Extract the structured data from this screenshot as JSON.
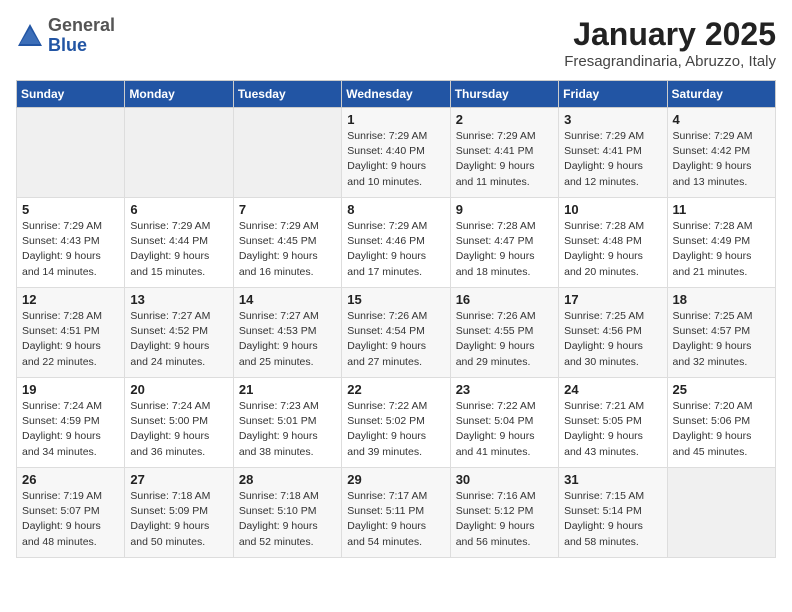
{
  "header": {
    "logo_general": "General",
    "logo_blue": "Blue",
    "month": "January 2025",
    "location": "Fresagrandinaria, Abruzzo, Italy"
  },
  "days_of_week": [
    "Sunday",
    "Monday",
    "Tuesday",
    "Wednesday",
    "Thursday",
    "Friday",
    "Saturday"
  ],
  "weeks": [
    [
      {
        "day": "",
        "info": ""
      },
      {
        "day": "",
        "info": ""
      },
      {
        "day": "",
        "info": ""
      },
      {
        "day": "1",
        "info": "Sunrise: 7:29 AM\nSunset: 4:40 PM\nDaylight: 9 hours\nand 10 minutes."
      },
      {
        "day": "2",
        "info": "Sunrise: 7:29 AM\nSunset: 4:41 PM\nDaylight: 9 hours\nand 11 minutes."
      },
      {
        "day": "3",
        "info": "Sunrise: 7:29 AM\nSunset: 4:41 PM\nDaylight: 9 hours\nand 12 minutes."
      },
      {
        "day": "4",
        "info": "Sunrise: 7:29 AM\nSunset: 4:42 PM\nDaylight: 9 hours\nand 13 minutes."
      }
    ],
    [
      {
        "day": "5",
        "info": "Sunrise: 7:29 AM\nSunset: 4:43 PM\nDaylight: 9 hours\nand 14 minutes."
      },
      {
        "day": "6",
        "info": "Sunrise: 7:29 AM\nSunset: 4:44 PM\nDaylight: 9 hours\nand 15 minutes."
      },
      {
        "day": "7",
        "info": "Sunrise: 7:29 AM\nSunset: 4:45 PM\nDaylight: 9 hours\nand 16 minutes."
      },
      {
        "day": "8",
        "info": "Sunrise: 7:29 AM\nSunset: 4:46 PM\nDaylight: 9 hours\nand 17 minutes."
      },
      {
        "day": "9",
        "info": "Sunrise: 7:28 AM\nSunset: 4:47 PM\nDaylight: 9 hours\nand 18 minutes."
      },
      {
        "day": "10",
        "info": "Sunrise: 7:28 AM\nSunset: 4:48 PM\nDaylight: 9 hours\nand 20 minutes."
      },
      {
        "day": "11",
        "info": "Sunrise: 7:28 AM\nSunset: 4:49 PM\nDaylight: 9 hours\nand 21 minutes."
      }
    ],
    [
      {
        "day": "12",
        "info": "Sunrise: 7:28 AM\nSunset: 4:51 PM\nDaylight: 9 hours\nand 22 minutes."
      },
      {
        "day": "13",
        "info": "Sunrise: 7:27 AM\nSunset: 4:52 PM\nDaylight: 9 hours\nand 24 minutes."
      },
      {
        "day": "14",
        "info": "Sunrise: 7:27 AM\nSunset: 4:53 PM\nDaylight: 9 hours\nand 25 minutes."
      },
      {
        "day": "15",
        "info": "Sunrise: 7:26 AM\nSunset: 4:54 PM\nDaylight: 9 hours\nand 27 minutes."
      },
      {
        "day": "16",
        "info": "Sunrise: 7:26 AM\nSunset: 4:55 PM\nDaylight: 9 hours\nand 29 minutes."
      },
      {
        "day": "17",
        "info": "Sunrise: 7:25 AM\nSunset: 4:56 PM\nDaylight: 9 hours\nand 30 minutes."
      },
      {
        "day": "18",
        "info": "Sunrise: 7:25 AM\nSunset: 4:57 PM\nDaylight: 9 hours\nand 32 minutes."
      }
    ],
    [
      {
        "day": "19",
        "info": "Sunrise: 7:24 AM\nSunset: 4:59 PM\nDaylight: 9 hours\nand 34 minutes."
      },
      {
        "day": "20",
        "info": "Sunrise: 7:24 AM\nSunset: 5:00 PM\nDaylight: 9 hours\nand 36 minutes."
      },
      {
        "day": "21",
        "info": "Sunrise: 7:23 AM\nSunset: 5:01 PM\nDaylight: 9 hours\nand 38 minutes."
      },
      {
        "day": "22",
        "info": "Sunrise: 7:22 AM\nSunset: 5:02 PM\nDaylight: 9 hours\nand 39 minutes."
      },
      {
        "day": "23",
        "info": "Sunrise: 7:22 AM\nSunset: 5:04 PM\nDaylight: 9 hours\nand 41 minutes."
      },
      {
        "day": "24",
        "info": "Sunrise: 7:21 AM\nSunset: 5:05 PM\nDaylight: 9 hours\nand 43 minutes."
      },
      {
        "day": "25",
        "info": "Sunrise: 7:20 AM\nSunset: 5:06 PM\nDaylight: 9 hours\nand 45 minutes."
      }
    ],
    [
      {
        "day": "26",
        "info": "Sunrise: 7:19 AM\nSunset: 5:07 PM\nDaylight: 9 hours\nand 48 minutes."
      },
      {
        "day": "27",
        "info": "Sunrise: 7:18 AM\nSunset: 5:09 PM\nDaylight: 9 hours\nand 50 minutes."
      },
      {
        "day": "28",
        "info": "Sunrise: 7:18 AM\nSunset: 5:10 PM\nDaylight: 9 hours\nand 52 minutes."
      },
      {
        "day": "29",
        "info": "Sunrise: 7:17 AM\nSunset: 5:11 PM\nDaylight: 9 hours\nand 54 minutes."
      },
      {
        "day": "30",
        "info": "Sunrise: 7:16 AM\nSunset: 5:12 PM\nDaylight: 9 hours\nand 56 minutes."
      },
      {
        "day": "31",
        "info": "Sunrise: 7:15 AM\nSunset: 5:14 PM\nDaylight: 9 hours\nand 58 minutes."
      },
      {
        "day": "",
        "info": ""
      }
    ]
  ]
}
